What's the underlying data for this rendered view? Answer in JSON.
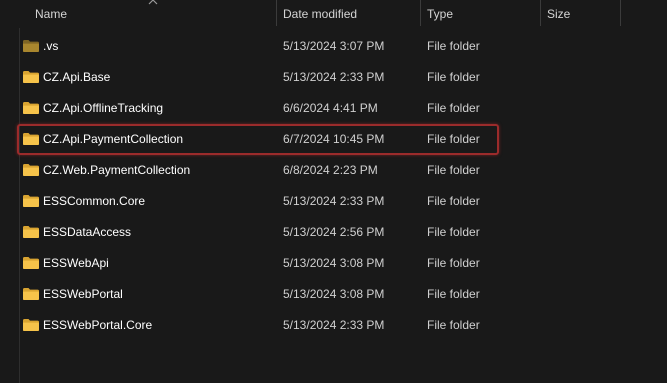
{
  "columns": {
    "name": "Name",
    "date_modified": "Date modified",
    "type": "Type",
    "size": "Size"
  },
  "sort": {
    "column": "name",
    "direction": "ascending"
  },
  "colors": {
    "folder": "#f6c34a",
    "folder_dim": "#a8862e",
    "highlight_border": "#9b2b2b",
    "background": "#191919"
  },
  "rows": [
    {
      "name": ".vs",
      "date": "5/13/2024 3:07 PM",
      "type": "File folder",
      "size": "",
      "hidden": true,
      "highlighted": false
    },
    {
      "name": "CZ.Api.Base",
      "date": "5/13/2024 2:33 PM",
      "type": "File folder",
      "size": "",
      "hidden": false,
      "highlighted": false
    },
    {
      "name": "CZ.Api.OfflineTracking",
      "date": "6/6/2024 4:41 PM",
      "type": "File folder",
      "size": "",
      "hidden": false,
      "highlighted": false
    },
    {
      "name": "CZ.Api.PaymentCollection",
      "date": "6/7/2024 10:45 PM",
      "type": "File folder",
      "size": "",
      "hidden": false,
      "highlighted": true
    },
    {
      "name": "CZ.Web.PaymentCollection",
      "date": "6/8/2024 2:23 PM",
      "type": "File folder",
      "size": "",
      "hidden": false,
      "highlighted": false
    },
    {
      "name": "ESSCommon.Core",
      "date": "5/13/2024 2:33 PM",
      "type": "File folder",
      "size": "",
      "hidden": false,
      "highlighted": false
    },
    {
      "name": "ESSDataAccess",
      "date": "5/13/2024 2:56 PM",
      "type": "File folder",
      "size": "",
      "hidden": false,
      "highlighted": false
    },
    {
      "name": "ESSWebApi",
      "date": "5/13/2024 3:08 PM",
      "type": "File folder",
      "size": "",
      "hidden": false,
      "highlighted": false
    },
    {
      "name": "ESSWebPortal",
      "date": "5/13/2024 3:08 PM",
      "type": "File folder",
      "size": "",
      "hidden": false,
      "highlighted": false
    },
    {
      "name": "ESSWebPortal.Core",
      "date": "5/13/2024 2:33 PM",
      "type": "File folder",
      "size": "",
      "hidden": false,
      "highlighted": false
    }
  ]
}
